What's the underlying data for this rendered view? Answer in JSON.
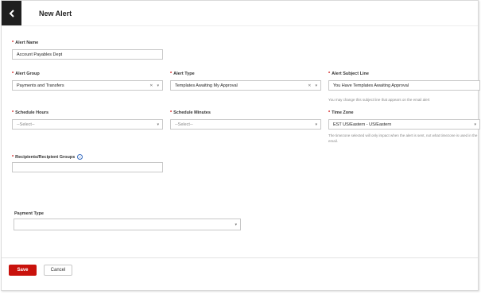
{
  "header": {
    "title": "New Alert"
  },
  "form": {
    "alert_name": {
      "label": "Alert Name",
      "value": "Account Payables Dept"
    },
    "alert_group": {
      "label": "Alert Group",
      "value": "Payments and Transfers"
    },
    "alert_type": {
      "label": "Alert Type",
      "value": "Templates Awaiting My Approval"
    },
    "alert_subject": {
      "label": "Alert Subject Line",
      "value": "You Have Templates Awaiting Approval",
      "help": "You may change this subject line that appears on the email alert"
    },
    "schedule_hours": {
      "label": "Schedule Hours",
      "placeholder": "--Select--"
    },
    "schedule_minutes": {
      "label": "Schedule Minutes",
      "placeholder": "--Select--"
    },
    "time_zone": {
      "label": "Time Zone",
      "value": "EST US/Eastern - US/Eastern",
      "help": "The timezone selected will only impact when the alert is sent, not what timezone is used in the email."
    },
    "recipients": {
      "label": "Recipients/Recipient Groups",
      "value": ""
    },
    "payment_type": {
      "label": "Payment Type",
      "value": ""
    }
  },
  "footer": {
    "save_label": "Save",
    "cancel_label": "Cancel"
  }
}
